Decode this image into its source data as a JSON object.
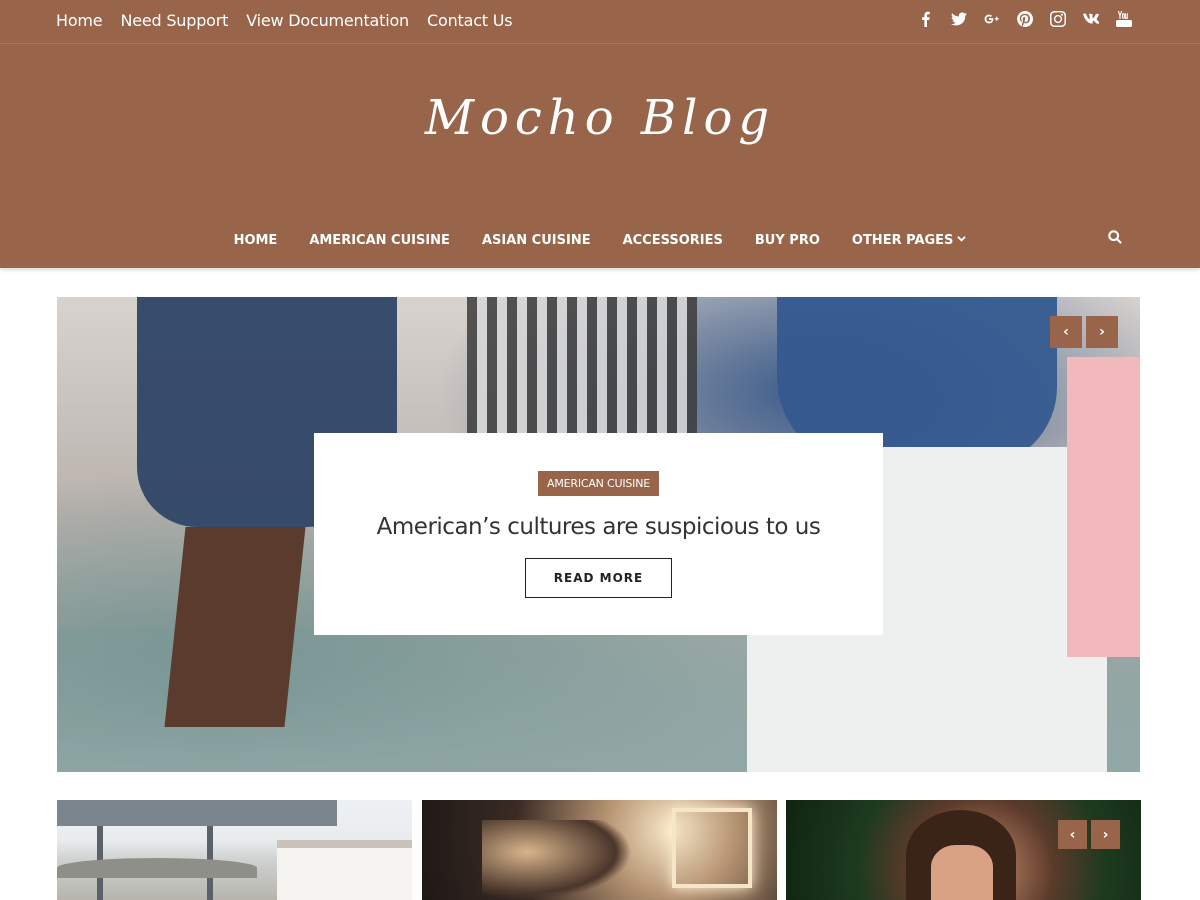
{
  "topbar": {
    "links": [
      "Home",
      "Need Support",
      "View Documentation",
      "Contact Us"
    ],
    "social_icons": [
      "facebook-icon",
      "twitter-icon",
      "google-plus-icon",
      "pinterest-icon",
      "instagram-icon",
      "vk-icon",
      "youtube-icon"
    ]
  },
  "header": {
    "logo": "Mocho Blog"
  },
  "nav": {
    "items": [
      "HOME",
      "AMERICAN CUISINE",
      "ASIAN CUISINE",
      "ACCESSORIES",
      "BUY PRO",
      "OTHER PAGES"
    ],
    "dropdown_icon": "chevron-down-icon",
    "search_icon": "search-icon"
  },
  "slider": {
    "prev": "‹",
    "next": "›",
    "category": "AMERICAN CUISINE",
    "title": "American’s cultures are suspicious to us",
    "button": "READ MORE"
  },
  "thumb_slider": {
    "prev": "‹",
    "next": "›"
  },
  "colors": {
    "brand": "#98654a",
    "text": "#333333",
    "white": "#ffffff"
  }
}
